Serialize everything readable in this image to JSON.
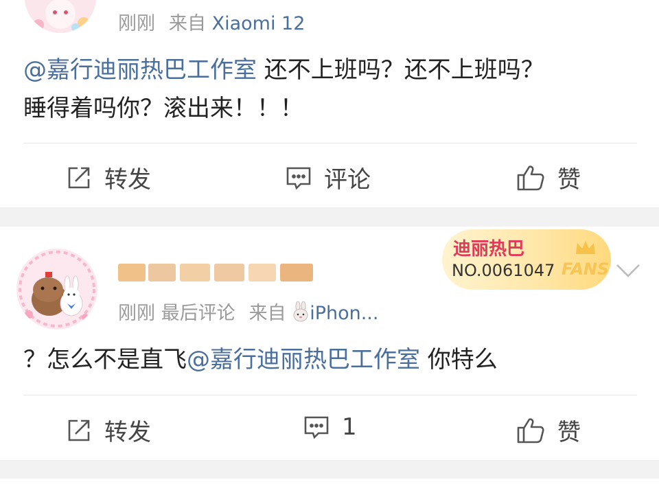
{
  "post1": {
    "time": "刚刚",
    "from_label": "来自",
    "device": "Xiaomi 12",
    "mention": "@嘉行迪丽热巴工作室",
    "line1_rest": " 还不上班吗？还不上班吗？",
    "line2": "睡得着吗你？滚出来！！！",
    "actions": {
      "repost": "转发",
      "comment": "评论",
      "like": "赞"
    }
  },
  "post2": {
    "time": "刚刚",
    "last_comment": "最后评论",
    "from_label": "来自",
    "device": "iPhon...",
    "badge": {
      "name": "迪丽热巴",
      "number": "NO.0061047",
      "fans": "FANS"
    },
    "content_prefix": "？怎么不是直飞",
    "mention": "@嘉行迪丽热巴工作室",
    "content_suffix": " 你特么",
    "actions": {
      "repost": "转发",
      "comment_count": "1",
      "like": "赞"
    }
  },
  "colors": {
    "mention": "#4a6f9c",
    "meta": "#9a9a9a",
    "background": "#f2f2f2"
  },
  "icons": [
    "repost-icon",
    "comment-icon",
    "like-icon",
    "chevron-down-icon",
    "crown-icon",
    "rabbit-icon"
  ]
}
